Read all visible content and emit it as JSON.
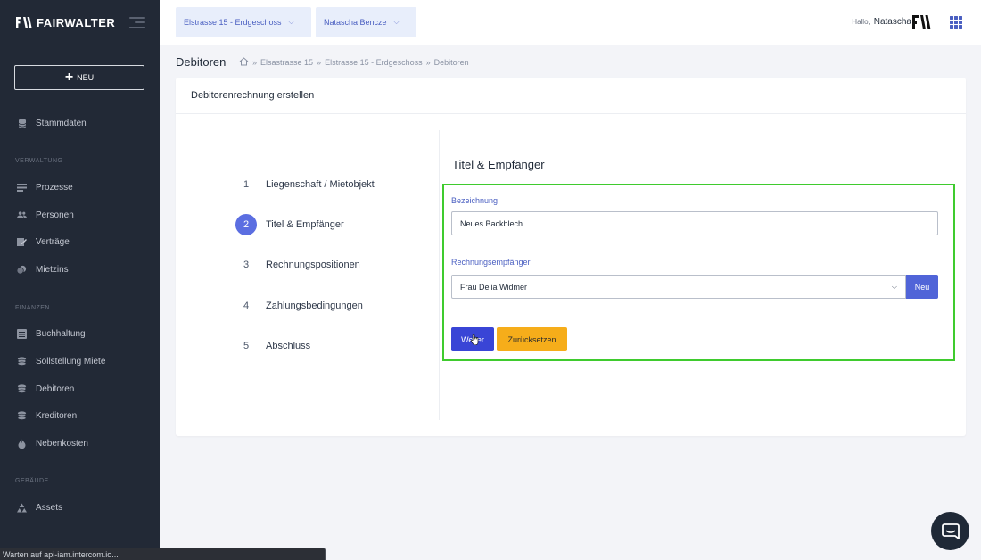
{
  "app": {
    "logo_text": "FAIRWALTER"
  },
  "sidebar": {
    "new_label": "NEU",
    "items": [
      {
        "label": "Stammdaten",
        "icon": "database-icon"
      },
      {
        "section": "VERWALTUNG"
      },
      {
        "label": "Prozesse",
        "icon": "list-icon"
      },
      {
        "label": "Personen",
        "icon": "users-icon"
      },
      {
        "label": "Verträge",
        "icon": "contract-edit-icon"
      },
      {
        "label": "Mietzins",
        "icon": "coins-icon"
      },
      {
        "section": "FINANZEN"
      },
      {
        "label": "Buchhaltung",
        "icon": "ledger-icon"
      },
      {
        "label": "Sollstellung Miete",
        "icon": "coins-stack-icon"
      },
      {
        "label": "Debitoren",
        "icon": "coins-stack-icon"
      },
      {
        "label": "Kreditoren",
        "icon": "coins-stack-icon"
      },
      {
        "label": "Nebenkosten",
        "icon": "flame-icon"
      },
      {
        "section": "GEBÄUDE"
      },
      {
        "label": "Assets",
        "icon": "assets-icon"
      }
    ]
  },
  "topbar": {
    "property_select": "Elstrasse 15 - Erdgeschoss",
    "person_select": "Natascha Bencze",
    "greeting": "Hallo,",
    "user_name": "Natascha"
  },
  "breadcrumb": {
    "page_title": "Debitoren",
    "items": [
      "Elsastrasse 15",
      "Elstrasse 15 - Erdgeschoss",
      "Debitoren"
    ],
    "separator": "»"
  },
  "card": {
    "title": "Debitorenrechnung erstellen",
    "steps": [
      {
        "num": "1",
        "label": "Liegenschaft / Mietobjekt"
      },
      {
        "num": "2",
        "label": "Titel & Empfänger"
      },
      {
        "num": "3",
        "label": "Rechnungspositionen"
      },
      {
        "num": "4",
        "label": "Zahlungsbedingungen"
      },
      {
        "num": "5",
        "label": "Abschluss"
      }
    ],
    "active_step": "2",
    "form": {
      "title": "Titel & Empfänger",
      "bezeichnung_label": "Bezeichnung",
      "bezeichnung_value": "Neues Backblech",
      "empfaenger_label": "Rechnungsempfänger",
      "empfaenger_value": "Frau Delia Widmer",
      "neu_label": "Neu",
      "weiter_label": "Weiter",
      "reset_label": "Zurücksetzen"
    }
  },
  "statusbar": {
    "text": "Warten auf api-iam.intercom.io..."
  },
  "colors": {
    "sidebar_bg": "#222936",
    "accent": "#4a5fc1",
    "primary_button": "#3945d6",
    "warning_button": "#f6ad1a",
    "highlight_border": "#3fcb2e"
  }
}
